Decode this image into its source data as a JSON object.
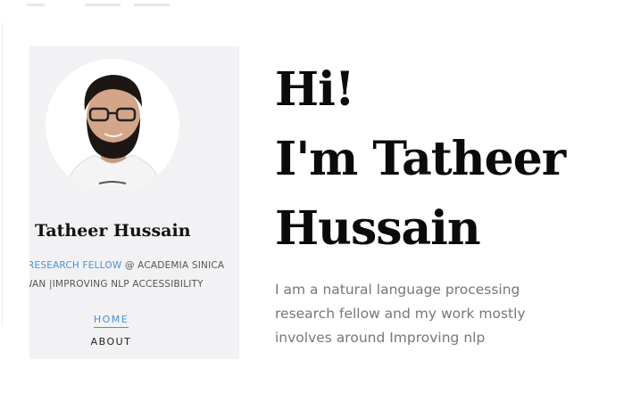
{
  "profile": {
    "name": "Tatheer Hussain",
    "role": "RESEARCH FELLOW",
    "affiliation_line1": " @ ACADEMIA SINICA",
    "affiliation_line2": "WAN |IMPROVING NLP ACCESSIBILITY"
  },
  "nav": {
    "items": [
      {
        "label": "HOME",
        "active": true
      },
      {
        "label": "ABOUT",
        "active": false
      }
    ]
  },
  "hero": {
    "line1": "Hi!",
    "line2": "I'm Tatheer",
    "line3": "Hussain",
    "intro": "I am a natural language processing research fellow and my work mostly involves around Improving nlp"
  },
  "colors": {
    "accent": "#4a90d9",
    "sidebar_bg": "#f2f2f4",
    "heading": "#0b0b0b",
    "body_text": "#777777"
  },
  "icons": {
    "avatar": "profile-photo"
  }
}
